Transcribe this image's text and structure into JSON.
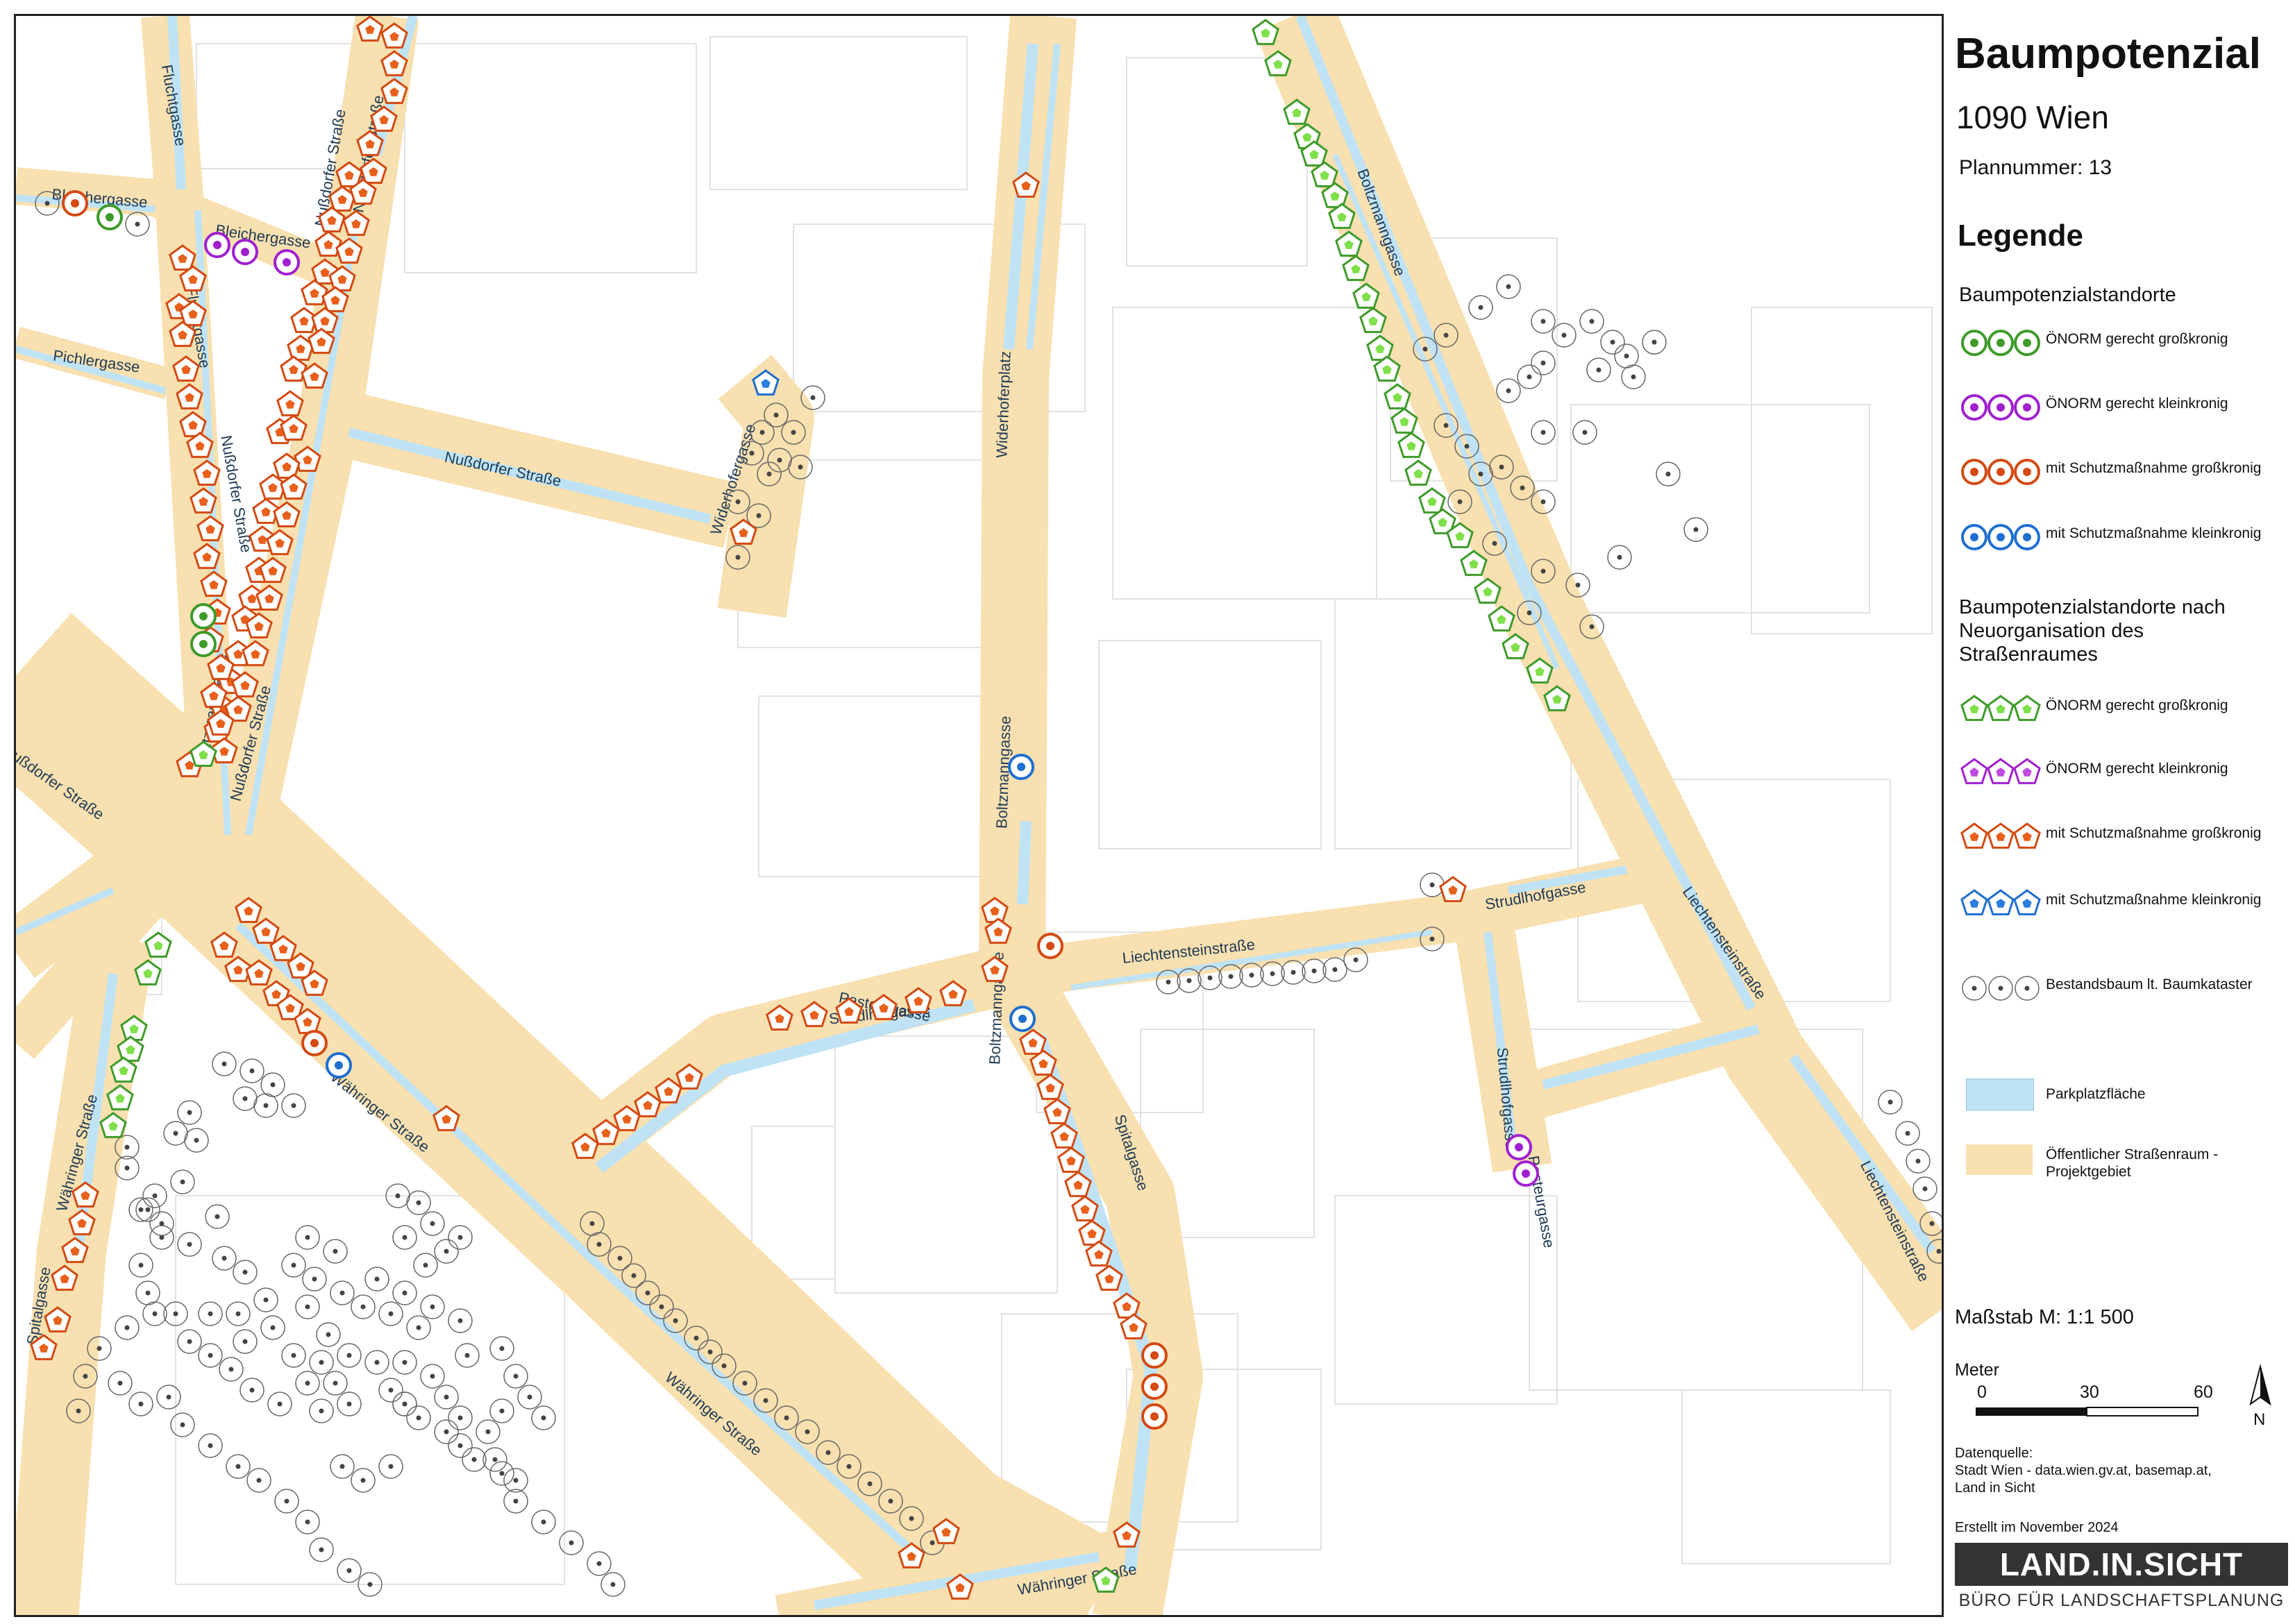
{
  "title": "Baumpotenzial",
  "subtitle": "1090 Wien",
  "plan_number": "Plannummer: 13",
  "legend": {
    "heading": "Legende",
    "group1_title": "Baumpotenzialstandorte",
    "group1_items": [
      {
        "label": "ÖNORM gerecht großkronig",
        "color": "#3e9b2a",
        "shape": "ring-circle"
      },
      {
        "label": "ÖNORM gerecht kleinkronig",
        "color": "#a020d0",
        "shape": "ring-circle"
      },
      {
        "label": "mit Schutzmaßnahme großkronig",
        "color": "#d44a12",
        "shape": "ring-circle"
      },
      {
        "label": "mit Schutzmaßnahme kleinkronig",
        "color": "#1f6fd0",
        "shape": "ring-circle"
      }
    ],
    "group2_title": "Baumpotenzialstandorte nach Neuorganisation des Straßenraumes",
    "group2_items": [
      {
        "label": "ÖNORM gerecht großkronig",
        "color": "#3e9b2a",
        "fill": "#7fe04a",
        "shape": "pentagon"
      },
      {
        "label": "ÖNORM gerecht kleinkronig",
        "color": "#a020d0",
        "fill": "#c04ae0",
        "shape": "pentagon"
      },
      {
        "label": "mit Schutzmaßnahme großkronig",
        "color": "#d44a12",
        "fill": "#e8601c",
        "shape": "pentagon"
      },
      {
        "label": "mit Schutzmaßnahme kleinkronig",
        "color": "#1f6fd0",
        "fill": "#2b7de0",
        "shape": "pentagon"
      }
    ],
    "existing_tree": {
      "label": "Bestandsbaum lt. Baumkataster",
      "color": "#555555"
    },
    "parking": {
      "label": "Parkplatzfläche",
      "color": "#bfe3f5"
    },
    "street_space": {
      "label": "Öffentlicher Straßenraum - Projektgebiet",
      "color": "#f8e0b0"
    }
  },
  "scale": {
    "label": "Maßstab M: 1:1 500",
    "unit": "Meter",
    "ticks": [
      "0",
      "30",
      "60"
    ],
    "north": "N"
  },
  "source": {
    "heading": "Datenquelle:",
    "line1": "Stadt Wien - data.wien.gv.at, basemap.at,",
    "line2": "Land in Sicht"
  },
  "created": "Erstellt im November 2024",
  "logo": {
    "text": "LAND.IN.SICHT",
    "subtitle": "BÜRO FÜR LANDSCHAFTSPLANUNG"
  },
  "map": {
    "street_labels": [
      "Fluchtgasse",
      "Bleichergasse",
      "Bleichergasse",
      "Nußdorfer Straße",
      "Nußdorfer Straße",
      "Pichlergasse",
      "Fluchtgasse",
      "Nußdorfer Straße",
      "Nußdorfer Straße",
      "Widerhofergasse",
      "Widerhoferplatz",
      "Boltzmanngasse",
      "Boltzmanngasse",
      "Boltzmanngasse",
      "Liechtensteinstraße",
      "Liechtensteinstraße",
      "Liechtensteinstraße",
      "Strudlhofgasse",
      "Strudlhofgasse",
      "Strudlhofgasse",
      "Pasteurgasse",
      "Pasteurgasse",
      "Währinger Straße",
      "Währinger Straße",
      "Währinger Straße",
      "Währinger Straße",
      "Spitalgasse",
      "Spitalgasse",
      "Boltzmanngasse",
      "Nußdorfer Straße",
      "Nußdorfer Straße"
    ]
  }
}
